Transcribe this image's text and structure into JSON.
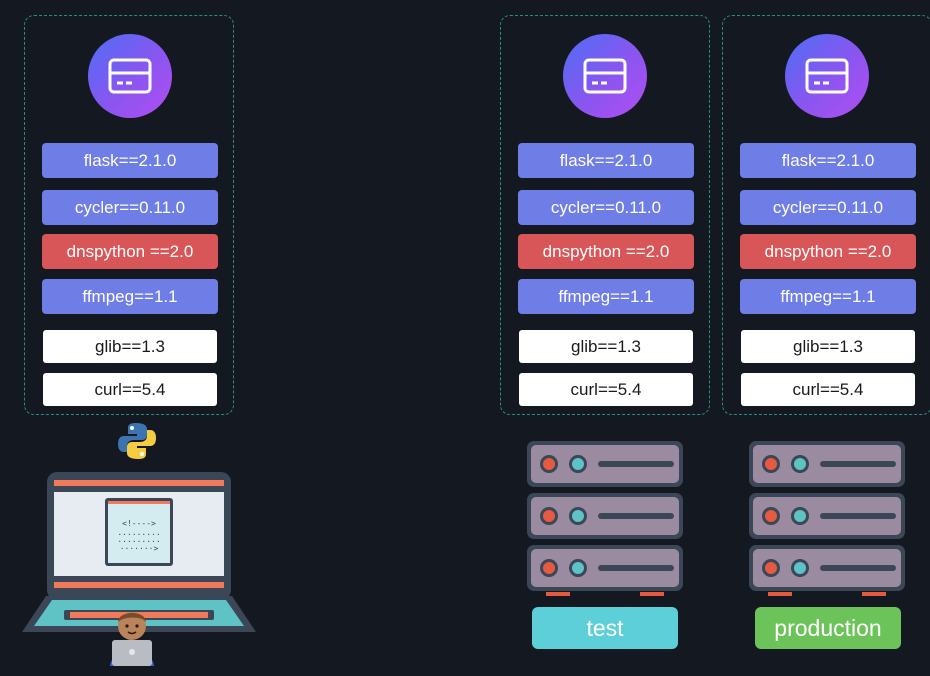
{
  "environments": [
    {
      "id": "dev",
      "packages": [
        {
          "name": "flask==2.1.0",
          "style": "blue"
        },
        {
          "name": "cycler==0.11.0",
          "style": "blue"
        },
        {
          "name": "dnspython ==2.0",
          "style": "red"
        },
        {
          "name": "ffmpeg==1.1",
          "style": "blue"
        },
        {
          "name": "glib==1.3",
          "style": "white"
        },
        {
          "name": "curl==5.4",
          "style": "white"
        }
      ]
    },
    {
      "id": "test",
      "label": "test",
      "packages": [
        {
          "name": "flask==2.1.0",
          "style": "blue"
        },
        {
          "name": "cycler==0.11.0",
          "style": "blue"
        },
        {
          "name": "dnspython ==2.0",
          "style": "red"
        },
        {
          "name": "ffmpeg==1.1",
          "style": "blue"
        },
        {
          "name": "glib==1.3",
          "style": "white"
        },
        {
          "name": "curl==5.4",
          "style": "white"
        }
      ]
    },
    {
      "id": "production",
      "label": "production",
      "packages": [
        {
          "name": "flask==2.1.0",
          "style": "blue"
        },
        {
          "name": "cycler==0.11.0",
          "style": "blue"
        },
        {
          "name": "dnspython ==2.0",
          "style": "red"
        },
        {
          "name": "ffmpeg==1.1",
          "style": "blue"
        },
        {
          "name": "glib==1.3",
          "style": "white"
        },
        {
          "name": "curl==5.4",
          "style": "white"
        }
      ]
    }
  ],
  "colors": {
    "package_blue": "#6f7de6",
    "package_red": "#d95658",
    "package_white": "#ffffff",
    "test_label": "#5ccfd8",
    "production_label": "#6cc35a",
    "panel_border": "#2f8a84",
    "background": "#141820"
  },
  "icons": {
    "environment_icon": "window-card-icon",
    "python_icon": "python-logo-icon",
    "laptop_icon": "laptop-code-icon",
    "developer_icon": "developer-avatar-icon",
    "server_icon": "server-rack-icon"
  }
}
